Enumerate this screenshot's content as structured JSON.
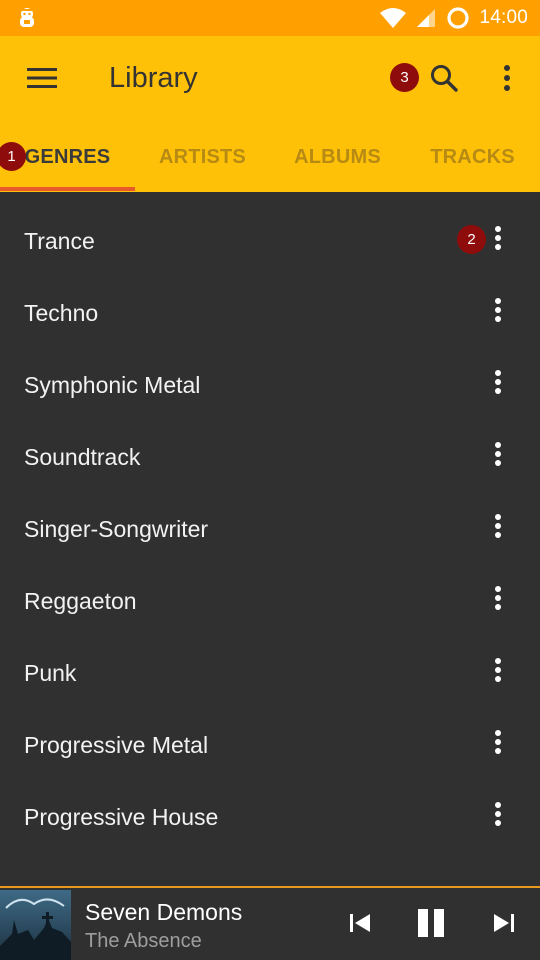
{
  "status_bar": {
    "time": "14:00",
    "icons": [
      "notification-app-icon",
      "wifi-icon",
      "cell-signal-icon",
      "battery-ring-icon"
    ]
  },
  "toolbar": {
    "title": "Library",
    "icons": [
      "menu-icon",
      "search-icon",
      "more-vert-icon"
    ],
    "search_badge": "3"
  },
  "tabs": {
    "items": [
      {
        "label": "GENRES",
        "active": true,
        "badge": "1"
      },
      {
        "label": "ARTISTS",
        "active": false
      },
      {
        "label": "ALBUMS",
        "active": false
      },
      {
        "label": "TRACKS",
        "active": false
      }
    ]
  },
  "genres": {
    "items": [
      {
        "label": "Trance",
        "badge": "2"
      },
      {
        "label": "Techno"
      },
      {
        "label": "Symphonic Metal"
      },
      {
        "label": "Soundtrack"
      },
      {
        "label": "Singer-Songwriter"
      },
      {
        "label": "Reggaeton"
      },
      {
        "label": "Punk"
      },
      {
        "label": "Progressive Metal"
      },
      {
        "label": "Progressive House"
      }
    ],
    "row_icon": "more-vert-icon"
  },
  "player": {
    "title": "Seven Demons",
    "artist": "The Absence",
    "controls": [
      "skip-previous-icon",
      "pause-icon",
      "skip-next-icon"
    ]
  },
  "colors": {
    "status_bar": "#FFA000",
    "toolbar": "#FFC107",
    "tab_indicator": "#E85A2A",
    "badge": "#8E0C0C",
    "list_background": "#303030",
    "player_divider": "#E89A1E"
  }
}
